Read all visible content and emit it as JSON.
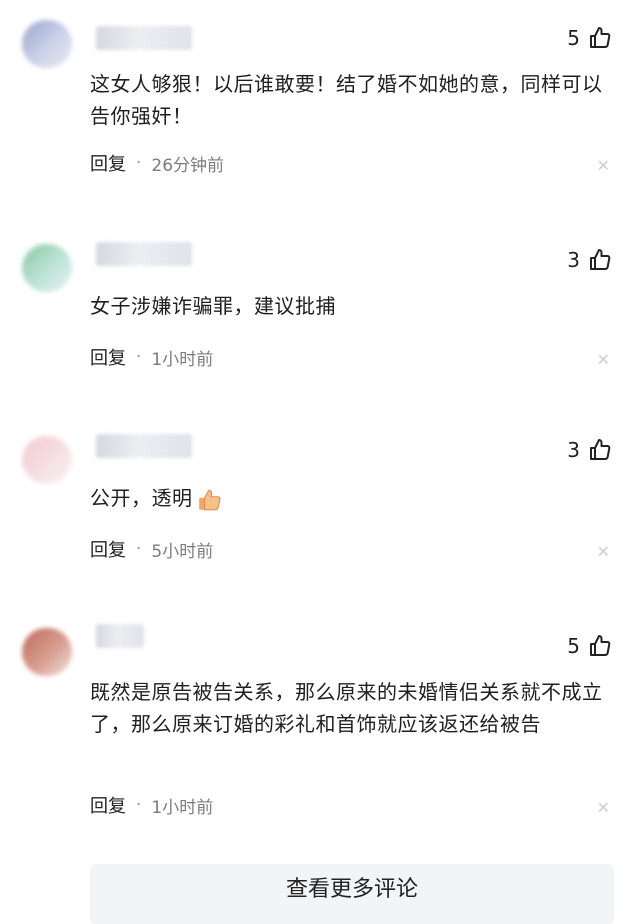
{
  "comments": [
    {
      "likes": "5",
      "text": "这女人够狠！以后谁敢要！结了婚不如她的意，同样可以告你强奸！",
      "reply": "回复",
      "time": "26分钟前"
    },
    {
      "likes": "3",
      "text": "女子涉嫌诈骗罪，建议批捕",
      "reply": "回复",
      "time": "1小时前"
    },
    {
      "likes": "3",
      "text": "公开，透明",
      "reply": "回复",
      "time": "5小时前"
    },
    {
      "likes": "5",
      "text": "既然是原告被告关系，那么原来的未婚情侣关系就不成立了，那么原来订婚的彩礼和首饰就应该返还给被告",
      "reply": "回复",
      "time": "1小时前"
    }
  ],
  "separator": "·",
  "more_comments_label": "查看更多评论",
  "icons": {
    "like": "thumbs-up-icon",
    "close": "close-icon",
    "emoji": "thumbs-up-emoji-icon"
  }
}
